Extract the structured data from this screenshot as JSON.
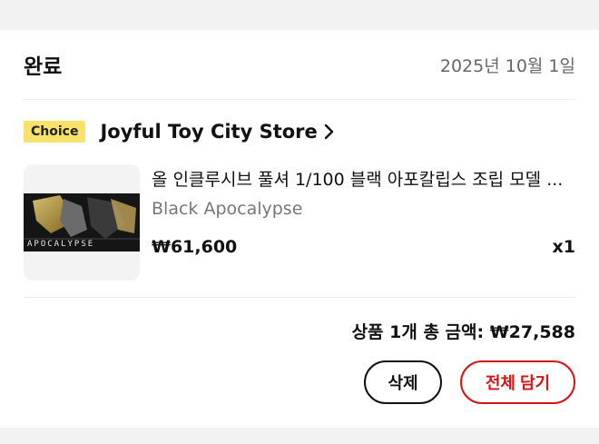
{
  "order": {
    "status": "완료",
    "date": "2025년 10월 1일"
  },
  "store": {
    "badge": "Choice",
    "name": "Joyful Toy City Store"
  },
  "item": {
    "title": "올 인클루시브 풀셔 1/100 블랙 아포칼립스 조립 모델 ...",
    "variant": "Black Apocalypse",
    "price": "₩61,600",
    "quantity": "x1",
    "thumbnail_text": "APOCALYPSE"
  },
  "summary": {
    "total_text": "상품 1개 총 금액: ₩27,588"
  },
  "actions": {
    "delete_label": "삭제",
    "add_all_label": "전체 담기"
  },
  "colors": {
    "badge": "#f7e36b",
    "accent": "#d41414"
  }
}
